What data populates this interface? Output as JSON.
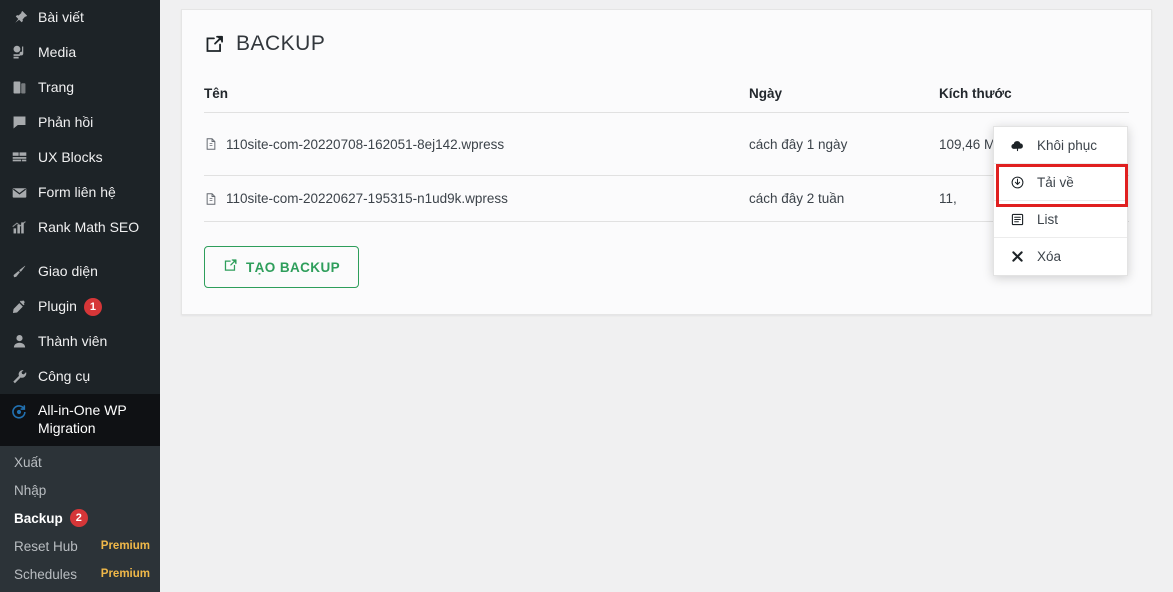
{
  "sidebar": {
    "items": [
      {
        "label": "Bài viết",
        "icon": "pin-icon"
      },
      {
        "label": "Media",
        "icon": "media-icon"
      },
      {
        "label": "Trang",
        "icon": "page-icon"
      },
      {
        "label": "Phản hồi",
        "icon": "comment-icon"
      },
      {
        "label": "UX Blocks",
        "icon": "blocks-icon"
      },
      {
        "label": "Form liên hệ",
        "icon": "envelope-icon"
      },
      {
        "label": "Rank Math SEO",
        "icon": "seo-icon"
      }
    ],
    "items2": [
      {
        "label": "Giao diện",
        "icon": "brush-icon"
      },
      {
        "label": "Plugin",
        "icon": "plugin-icon",
        "badge": "1"
      },
      {
        "label": "Thành viên",
        "icon": "user-icon"
      },
      {
        "label": "Công cụ",
        "icon": "wrench-icon"
      }
    ],
    "active": {
      "label": "All-in-One WP Migration",
      "icon": "migration-icon"
    },
    "submenu": [
      {
        "label": "Xuất"
      },
      {
        "label": "Nhập"
      },
      {
        "label": "Backup",
        "badge": "2",
        "current": true
      },
      {
        "label": "Reset Hub",
        "tag": "Premium"
      },
      {
        "label": "Schedules",
        "tag": "Premium"
      }
    ],
    "colors": {
      "bg": "#1d2327",
      "submenu_bg": "#2c3338",
      "badge": "#d63638",
      "premium": "#f0b849"
    }
  },
  "card": {
    "title": "BACKUP",
    "title_icon": "export-icon",
    "table": {
      "columns": [
        "Tên",
        "Ngày",
        "Kích thước"
      ],
      "rows": [
        {
          "name": "110site-com-20220708-162051-8ej142.wpress",
          "date": "cách đây 1 ngày",
          "size": "109,46 MB"
        },
        {
          "name": "110site-com-20220627-195315-n1ud9k.wpress",
          "date": "cách đây 2 tuần",
          "size": "11,"
        }
      ]
    },
    "create_button": {
      "label": "TẠO BACKUP",
      "icon": "export-icon",
      "color": "#2e9e5b"
    }
  },
  "dropdown": {
    "items": [
      {
        "label": "Khôi phục",
        "icon": "cloud-upload-icon"
      },
      {
        "label": "Tải về",
        "icon": "download-circle-icon",
        "highlighted": true
      },
      {
        "label": "List",
        "icon": "list-icon"
      },
      {
        "label": "Xóa",
        "icon": "close-x-icon"
      }
    ],
    "highlight_color": "#e02020"
  }
}
